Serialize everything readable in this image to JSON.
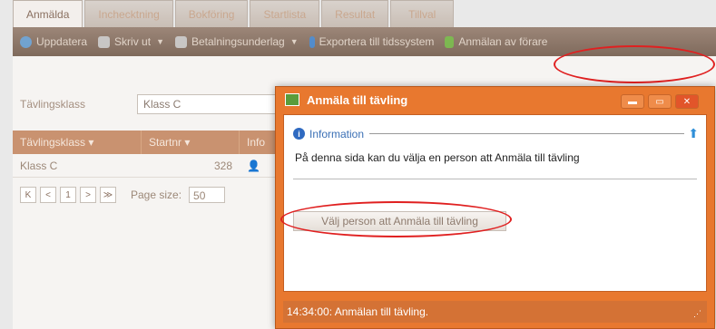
{
  "tabs": [
    "Anmälda",
    "Inchecktning",
    "Bokföring",
    "Startlista",
    "Resultat",
    "Tillval"
  ],
  "toolbar": {
    "refresh": "Uppdatera",
    "print": "Skriv ut",
    "payment": "Betalningsunderlag",
    "export": "Exportera till tidssystem",
    "register": "Anmälan av förare"
  },
  "filter": {
    "label": "Tävlingsklass",
    "value": "Klass C"
  },
  "grid": {
    "headers": [
      "Tävlingsklass",
      "Startnr",
      "Info"
    ],
    "row": {
      "klass": "Klass C",
      "startnr": "328"
    }
  },
  "pager": {
    "page": "1",
    "page_size_label": "Page size:",
    "page_size": "50"
  },
  "dialog": {
    "title": "Anmäla till tävling",
    "info_label": "Information",
    "info_text": "På denna sida kan du välja en person att Anmäla till tävling",
    "button": "Välj person att Anmäla till tävling",
    "status": "14:34:00: Anmälan till tävling."
  },
  "colors": {
    "accent": "#e8782f",
    "toolbar": "#8b7568",
    "annotation": "#e02020"
  }
}
